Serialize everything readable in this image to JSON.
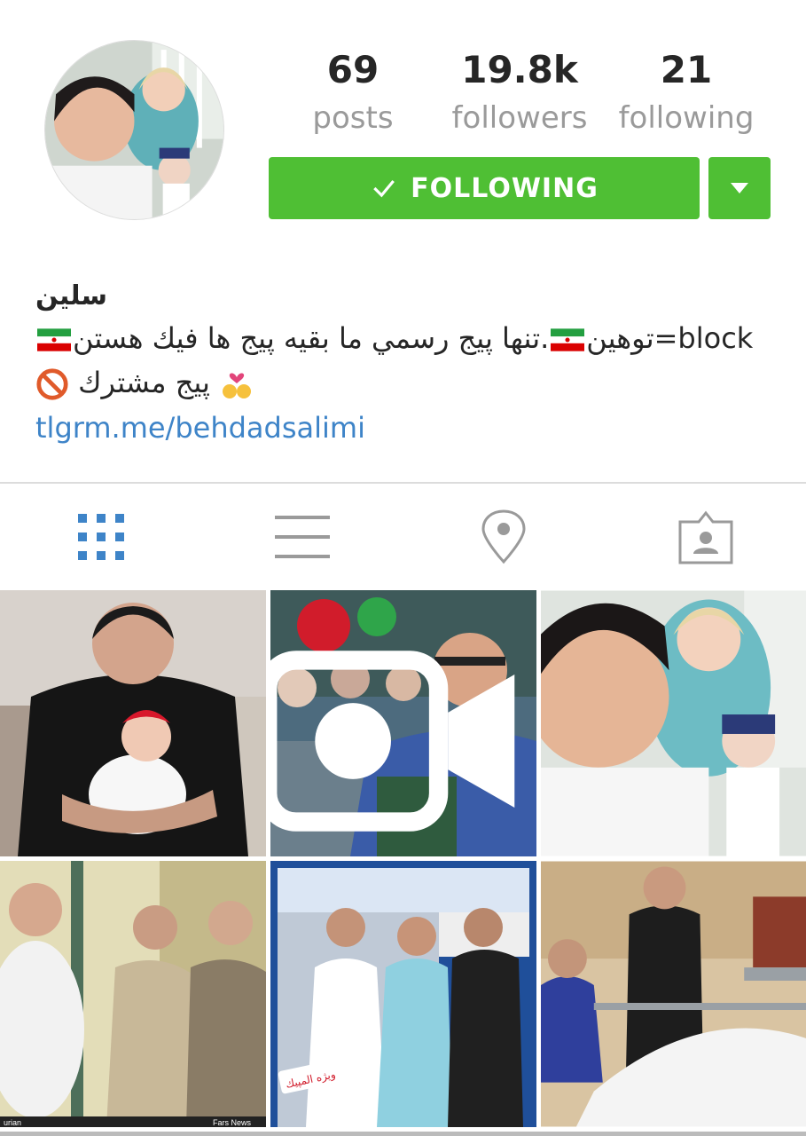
{
  "profile": {
    "posts_count": "69",
    "posts_label": "posts",
    "followers_count": "19.8k",
    "followers_label": "followers",
    "following_count": "21",
    "following_label": "following",
    "follow_button_label": "FOLLOWING"
  },
  "bio": {
    "name": "سلين",
    "line1_a": "block=توهين",
    "line1_b": ".تنها پيج رسمي ما بقيه پيج ها فيك هستن",
    "line2": "پيج مشترك",
    "link": "tlgrm.me/behdadsalimi"
  },
  "tabs": [
    {
      "name": "grid-view",
      "icon": "grid-icon",
      "active": true
    },
    {
      "name": "list-view",
      "icon": "list-icon",
      "active": false
    },
    {
      "name": "places",
      "icon": "location-pin-icon",
      "active": false
    },
    {
      "name": "tagged",
      "icon": "tagged-person-icon",
      "active": false
    }
  ],
  "colors": {
    "accent_green": "#4fbf34",
    "link_blue": "#3e84c8",
    "active_tab_blue": "#3e84c8",
    "muted_gray": "#9a9a9a"
  },
  "grid": {
    "tiles": [
      {
        "desc": "photo",
        "video": false
      },
      {
        "desc": "photo",
        "video": true
      },
      {
        "desc": "photo",
        "video": false
      },
      {
        "desc": "photo",
        "video": false
      },
      {
        "desc": "photo",
        "video": false
      },
      {
        "desc": "photo",
        "video": false
      }
    ],
    "tile4_caption_left": "urian",
    "tile4_caption_right": "Fars News",
    "tile5_banner": "ويژه المپيك"
  }
}
